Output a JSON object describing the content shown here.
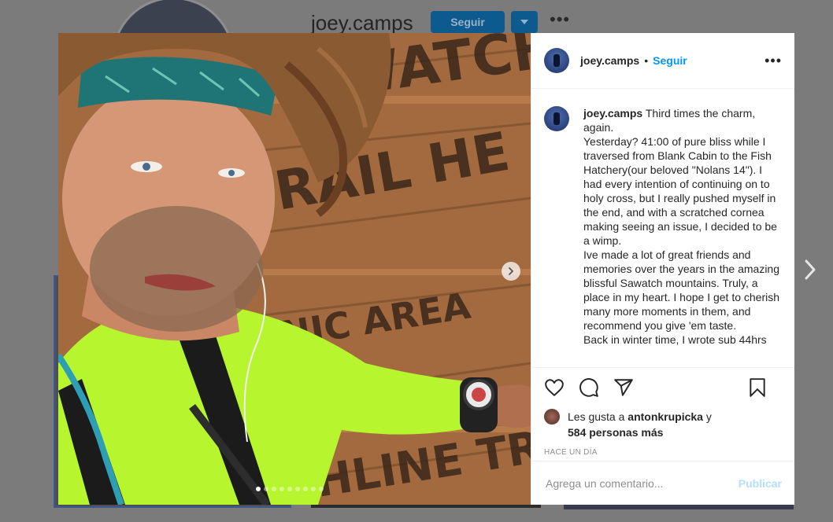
{
  "background": {
    "username": "joey.camps",
    "follow_label": "Seguir",
    "more_icon": "more-horizontal-icon"
  },
  "post": {
    "header": {
      "username": "joey.camps",
      "separator": "•",
      "follow_label": "Seguir",
      "more_label": "•••"
    },
    "caption": {
      "username": "joey.camps",
      "lines": [
        "Third times the charm, again.",
        "Yesterday? 41:00 of pure bliss while I traversed from Blank Cabin to the Fish Hatchery(our beloved \"Nolans 14\"). I had every intention of continuing on to holy cross, but I really pushed myself in the end, and with a scratched cornea making seeing an issue, I decided to be a wimp.",
        "Ive made a lot of great friends and memories over the years in the amazing blissful Sawatch mountains. Truly, a place in my heart. I hope I get to cherish many more moments in them, and recommend you give 'em taste.",
        "Back in winter time, I wrote sub 44hrs"
      ]
    },
    "likes": {
      "prefix": "Les gusta a",
      "user": "antonkrupicka",
      "suffix": "y",
      "others": "584 personas más"
    },
    "time": "HACE UN DÍA",
    "comment": {
      "placeholder": "Agrega un comentario...",
      "publish_label": "Publicar"
    },
    "carousel": {
      "total_images": 9,
      "current_index": 1
    },
    "photo_sign": {
      "lines": [
        "WATCH",
        "RAIL HE",
        "NIC AREA",
        "HLINE TRA"
      ]
    }
  }
}
